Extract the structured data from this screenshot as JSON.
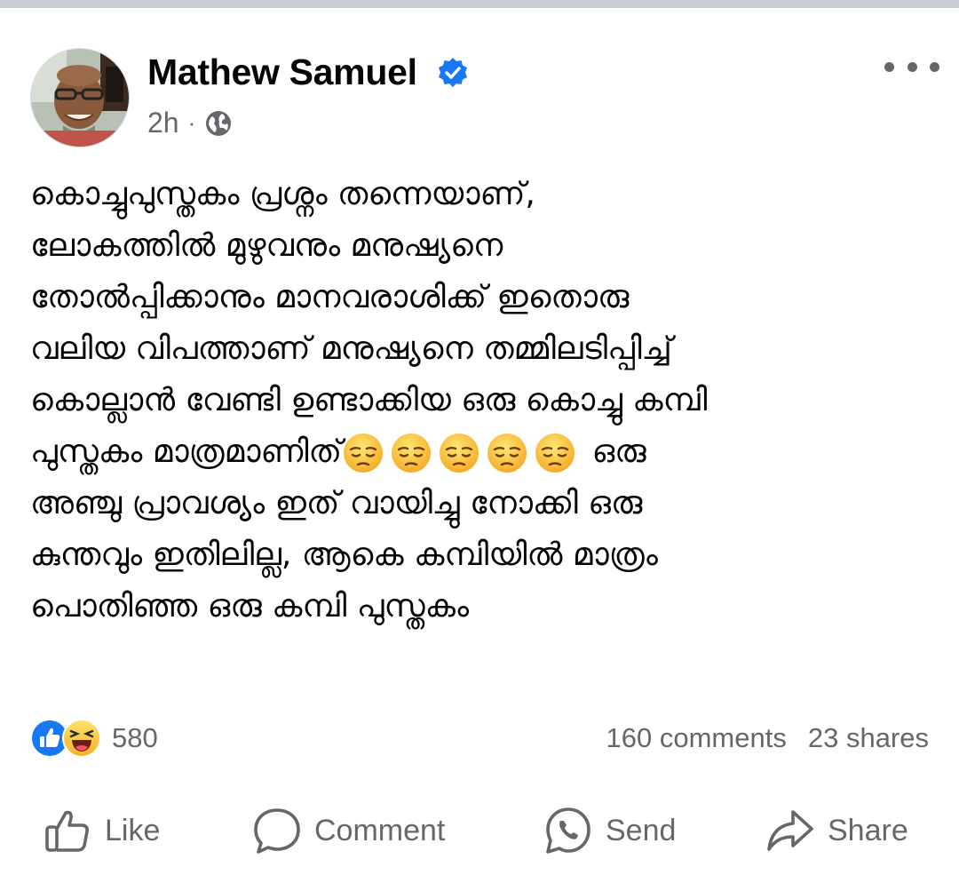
{
  "post": {
    "author": "Mathew Samuel",
    "time": "2h",
    "separator": "·",
    "icons": {
      "verified": "verified-badge-icon",
      "audience": "globe-icon",
      "menu": "more-options-icon"
    },
    "lines": [
      "കൊച്ചുപുസ്തകം പ്രശ്നം തന്നെയാണ്,",
      "ലോകത്തിൽ മുഴുവനും മനുഷ്യനെ",
      "തോൽപ്പിക്കാനും മാനവരാശിക്ക്  ഇതൊരു",
      "വലിയ വിപത്താണ് മനുഷ്യനെ തമ്മിലടിപ്പിച്ച്",
      "കൊല്ലാൻ വേണ്ടി ഉണ്ടാക്കിയ ഒരു കൊച്ചു കമ്പി",
      "പുസ്തകം മാത്രമാണിത്",
      "അഞ്ചു പ്രാവശ്യം ഇത് വായിച്ചു നോക്കി  ഒരു",
      "കുന്തവും ഇതിലില്ല, ആകെ കമ്പിയിൽ മാത്രം",
      "പൊതിഞ്ഞ  ഒരു കമ്പി പുസ്തകം"
    ],
    "line6_suffix": "ഒരു",
    "emoji": {
      "name": "pensive-face-emoji",
      "count": 5
    }
  },
  "engagement": {
    "reaction_icons": [
      "like-reaction-icon",
      "haha-reaction-icon"
    ],
    "reaction_count": "580",
    "comments": "160 comments",
    "shares": "23 shares"
  },
  "actions": {
    "like": "Like",
    "comment": "Comment",
    "send": "Send",
    "share": "Share"
  },
  "colors": {
    "text": "#050505",
    "secondary": "#65676b",
    "verified_blue": "#1877f2",
    "divider": "#c9ccd1"
  }
}
